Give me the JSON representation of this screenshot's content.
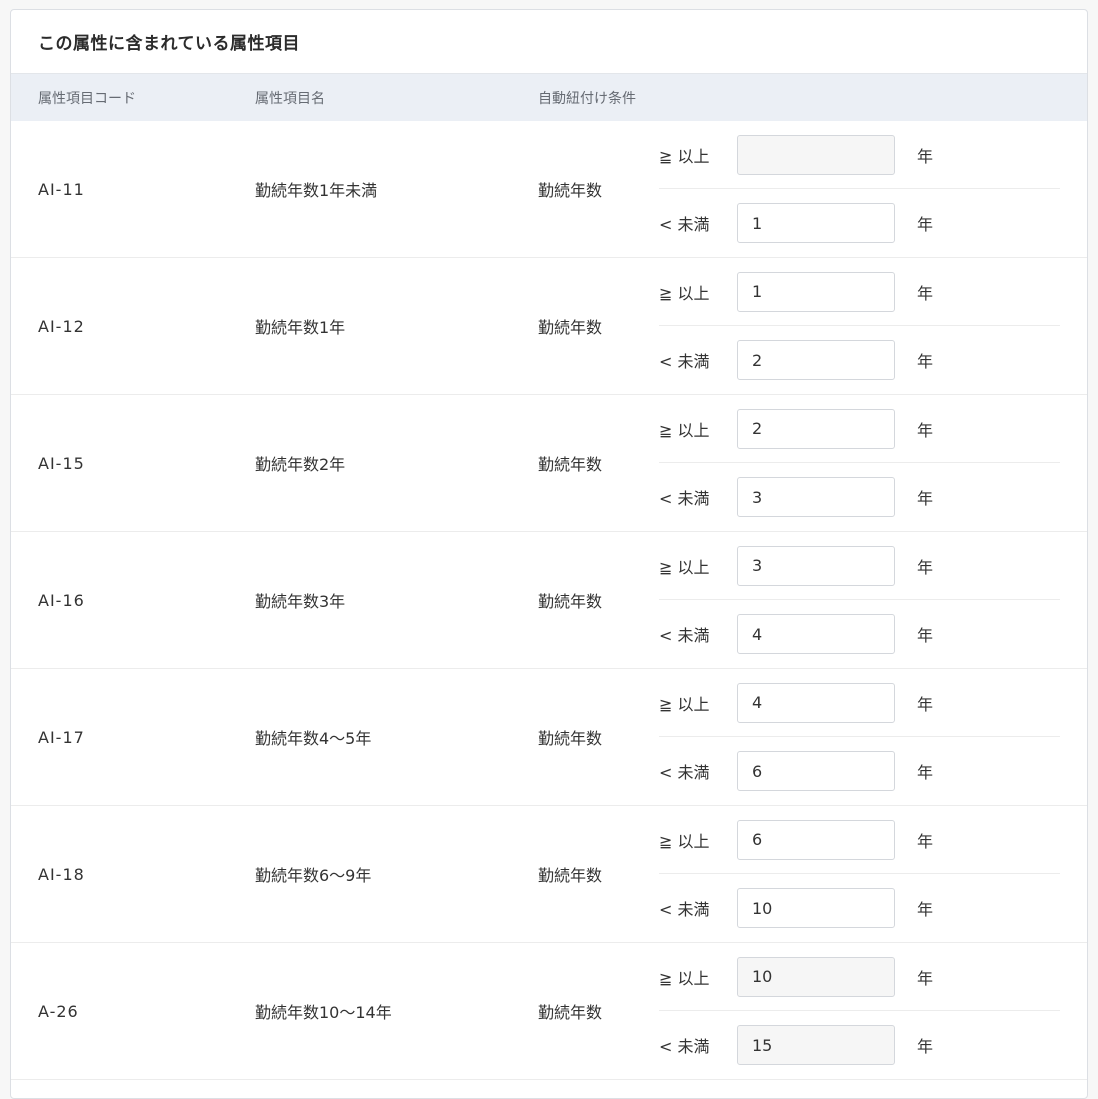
{
  "panel": {
    "title": "この属性に含まれている属性項目"
  },
  "table": {
    "headers": {
      "code": "属性項目コード",
      "name": "属性項目名",
      "condition": "自動紐付け条件"
    },
    "operators": {
      "gte": "≧ 以上",
      "lt": "< 未満"
    },
    "unit": "年",
    "rows": [
      {
        "code": "AI-11",
        "name": "勤続年数1年未満",
        "condition": "勤続年数",
        "min": "",
        "max": "1",
        "disabled": false,
        "min_disabled": true
      },
      {
        "code": "AI-12",
        "name": "勤続年数1年",
        "condition": "勤続年数",
        "min": "1",
        "max": "2",
        "disabled": false,
        "min_disabled": false
      },
      {
        "code": "AI-15",
        "name": "勤続年数2年",
        "condition": "勤続年数",
        "min": "2",
        "max": "3",
        "disabled": false,
        "min_disabled": false
      },
      {
        "code": "AI-16",
        "name": "勤続年数3年",
        "condition": "勤続年数",
        "min": "3",
        "max": "4",
        "disabled": false,
        "min_disabled": false
      },
      {
        "code": "AI-17",
        "name": "勤続年数4～5年",
        "condition": "勤続年数",
        "min": "4",
        "max": "6",
        "disabled": false,
        "min_disabled": false
      },
      {
        "code": "AI-18",
        "name": "勤続年数6～9年",
        "condition": "勤続年数",
        "min": "6",
        "max": "10",
        "disabled": false,
        "min_disabled": false
      },
      {
        "code": "A-26",
        "name": "勤続年数10～14年",
        "condition": "勤続年数",
        "min": "10",
        "max": "15",
        "disabled": true,
        "min_disabled": true
      }
    ]
  }
}
